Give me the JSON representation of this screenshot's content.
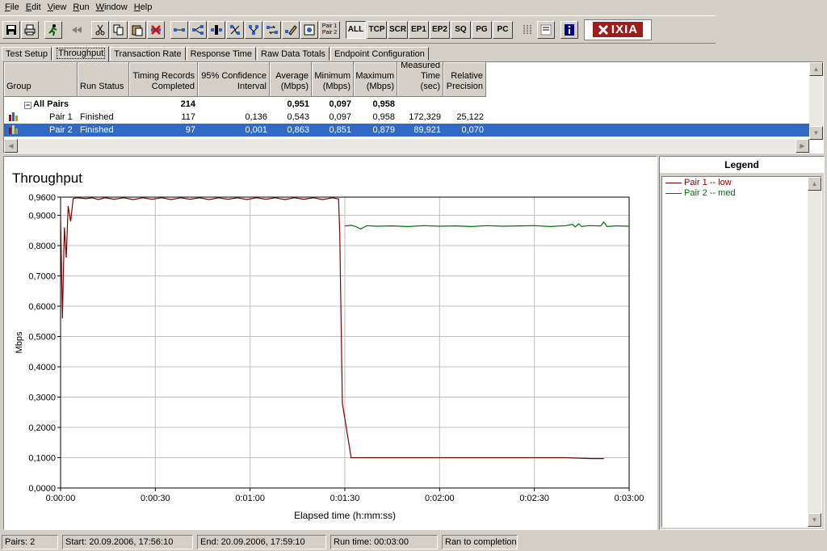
{
  "menu": [
    {
      "ul": "F",
      "rest": "ile"
    },
    {
      "ul": "E",
      "rest": "dit"
    },
    {
      "ul": "V",
      "rest": "iew"
    },
    {
      "ul": "R",
      "rest": "un"
    },
    {
      "ul": "W",
      "rest": "indow"
    },
    {
      "ul": "H",
      "rest": "elp"
    }
  ],
  "toolbar": {
    "filter_buttons": [
      "ALL",
      "TCP",
      "SCR",
      "EP1",
      "EP2",
      "SQ",
      "PG",
      "PC"
    ],
    "pair_button": [
      "Pair 1",
      "Pair 2"
    ],
    "logo": "IXIA"
  },
  "tabs": [
    "Test Setup",
    "Throughput",
    "Transaction Rate",
    "Response Time",
    "Raw Data Totals",
    "Endpoint Configuration"
  ],
  "table": {
    "headers": [
      "Group",
      "Run Status",
      "Timing Records\nCompleted",
      "95% Confidence\nInterval",
      "Average\n(Mbps)",
      "Minimum\n(Mbps)",
      "Maximum\n(Mbps)",
      "Measured\nTime (sec)",
      "Relative\nPrecision"
    ],
    "all_pairs": {
      "label": "All Pairs",
      "records": "214",
      "average": "0,951",
      "minimum": "0,097",
      "maximum": "0,958"
    },
    "rows": [
      {
        "group": "Pair 1",
        "status": "Finished",
        "records": "117",
        "ci": "0,136",
        "average": "0,543",
        "minimum": "0,097",
        "maximum": "0,958",
        "time": "172,329",
        "precision": "25,122"
      },
      {
        "group": "Pair 2",
        "status": "Finished",
        "records": "97",
        "ci": "0,001",
        "average": "0,863",
        "minimum": "0,851",
        "maximum": "0,879",
        "time": "89,921",
        "precision": "0,070"
      }
    ]
  },
  "chart_data": {
    "type": "line",
    "title": "Throughput",
    "xlabel": "Elapsed time (h:mm:ss)",
    "ylabel": "Mbps",
    "xlim": [
      0,
      180
    ],
    "ylim": [
      0,
      0.96
    ],
    "x_ticks": [
      {
        "v": 0,
        "label": "0:00:00"
      },
      {
        "v": 30,
        "label": "0:00:30"
      },
      {
        "v": 60,
        "label": "0:01:00"
      },
      {
        "v": 90,
        "label": "0:01:30"
      },
      {
        "v": 120,
        "label": "0:02:00"
      },
      {
        "v": 150,
        "label": "0:02:30"
      },
      {
        "v": 180,
        "label": "0:03:00"
      }
    ],
    "y_ticks": [
      {
        "v": 0,
        "label": "0,0000"
      },
      {
        "v": 0.1,
        "label": "0,1000"
      },
      {
        "v": 0.2,
        "label": "0,2000"
      },
      {
        "v": 0.3,
        "label": "0,3000"
      },
      {
        "v": 0.4,
        "label": "0,4000"
      },
      {
        "v": 0.5,
        "label": "0,5000"
      },
      {
        "v": 0.6,
        "label": "0,6000"
      },
      {
        "v": 0.7,
        "label": "0,7000"
      },
      {
        "v": 0.8,
        "label": "0,8000"
      },
      {
        "v": 0.9,
        "label": "0,9000"
      },
      {
        "v": 0.96,
        "label": "0,9600"
      }
    ],
    "grid": true,
    "series": [
      {
        "name": "Pair 1 -- low",
        "color": "#800000",
        "points": [
          [
            0,
            0.9
          ],
          [
            0.6,
            0.56
          ],
          [
            1.2,
            0.86
          ],
          [
            1.8,
            0.76
          ],
          [
            2.4,
            0.93
          ],
          [
            3.2,
            0.88
          ],
          [
            4,
            0.955
          ],
          [
            5,
            0.958
          ],
          [
            8,
            0.955
          ],
          [
            10,
            0.958
          ],
          [
            12,
            0.952
          ],
          [
            14,
            0.958
          ],
          [
            17,
            0.953
          ],
          [
            20,
            0.958
          ],
          [
            23,
            0.952
          ],
          [
            26,
            0.958
          ],
          [
            29,
            0.953
          ],
          [
            32,
            0.958
          ],
          [
            35,
            0.952
          ],
          [
            38,
            0.958
          ],
          [
            41,
            0.953
          ],
          [
            44,
            0.958
          ],
          [
            47,
            0.952
          ],
          [
            50,
            0.958
          ],
          [
            53,
            0.953
          ],
          [
            56,
            0.958
          ],
          [
            59,
            0.952
          ],
          [
            62,
            0.958
          ],
          [
            65,
            0.953
          ],
          [
            68,
            0.958
          ],
          [
            71,
            0.952
          ],
          [
            74,
            0.958
          ],
          [
            77,
            0.953
          ],
          [
            80,
            0.958
          ],
          [
            83,
            0.952
          ],
          [
            86,
            0.958
          ],
          [
            88,
            0.954
          ],
          [
            88.4,
            0.84
          ],
          [
            89.2,
            0.28
          ],
          [
            92,
            0.1
          ],
          [
            100,
            0.1
          ],
          [
            120,
            0.1
          ],
          [
            140,
            0.1
          ],
          [
            160,
            0.1
          ],
          [
            168,
            0.097
          ],
          [
            172,
            0.097
          ]
        ]
      },
      {
        "name": "Pair 2 -- med",
        "color": "#007000",
        "points": [
          [
            90,
            0.865
          ],
          [
            92,
            0.867
          ],
          [
            93.5,
            0.863
          ],
          [
            95,
            0.855
          ],
          [
            97,
            0.866
          ],
          [
            100,
            0.864
          ],
          [
            105,
            0.865
          ],
          [
            110,
            0.863
          ],
          [
            115,
            0.866
          ],
          [
            120,
            0.864
          ],
          [
            125,
            0.865
          ],
          [
            130,
            0.863
          ],
          [
            135,
            0.866
          ],
          [
            140,
            0.864
          ],
          [
            145,
            0.865
          ],
          [
            150,
            0.866
          ],
          [
            155,
            0.863
          ],
          [
            160,
            0.866
          ],
          [
            162,
            0.87
          ],
          [
            163,
            0.862
          ],
          [
            164,
            0.872
          ],
          [
            165,
            0.863
          ],
          [
            167,
            0.866
          ],
          [
            171,
            0.865
          ],
          [
            172,
            0.878
          ],
          [
            173,
            0.863
          ],
          [
            176,
            0.865
          ],
          [
            180,
            0.864
          ]
        ]
      }
    ]
  },
  "legend": {
    "title": "Legend",
    "items": [
      {
        "label": "Pair 1 -- low",
        "color": "#800000"
      },
      {
        "label": "Pair 2 -- med",
        "color": "#007000"
      }
    ]
  },
  "status": {
    "pairs": "Pairs: 2",
    "start": "Start: 20.09.2006, 17:56:10",
    "end": "End: 20.09.2006, 17:59:10",
    "runtime": "Run time: 00:03:00",
    "state": "Ran to completion"
  }
}
